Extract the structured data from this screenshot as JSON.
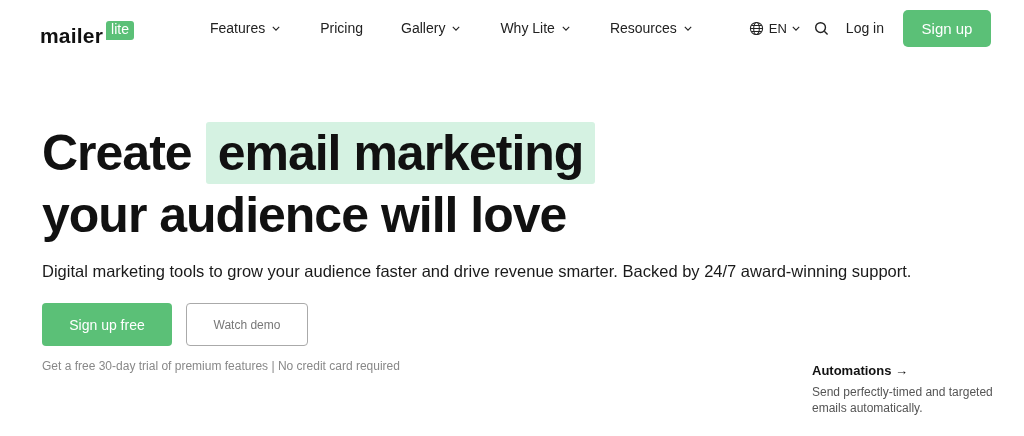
{
  "logo": {
    "word": "mailer",
    "badge": "lite"
  },
  "nav": [
    {
      "label": "Features",
      "has_menu": true
    },
    {
      "label": "Pricing",
      "has_menu": false
    },
    {
      "label": "Gallery",
      "has_menu": true
    },
    {
      "label": "Why Lite",
      "has_menu": true
    },
    {
      "label": "Resources",
      "has_menu": true
    }
  ],
  "language": {
    "label": "EN"
  },
  "login": "Log in",
  "signup": "Sign up",
  "hero": {
    "title_start": "Create",
    "title_highlight": "email marketing",
    "title_end": "your audience will love",
    "subtitle": "Digital marketing tools to grow your audience faster and drive revenue smarter. Backed by 24/7 award-winning support.",
    "primary_button": "Sign up free",
    "secondary_button": "Watch demo",
    "note": "Get a free 30-day trial of premium features | No credit card required"
  },
  "feature": {
    "title": "Automations",
    "arrow": "→",
    "description": "Send perfectly-timed and targeted emails automatically."
  }
}
